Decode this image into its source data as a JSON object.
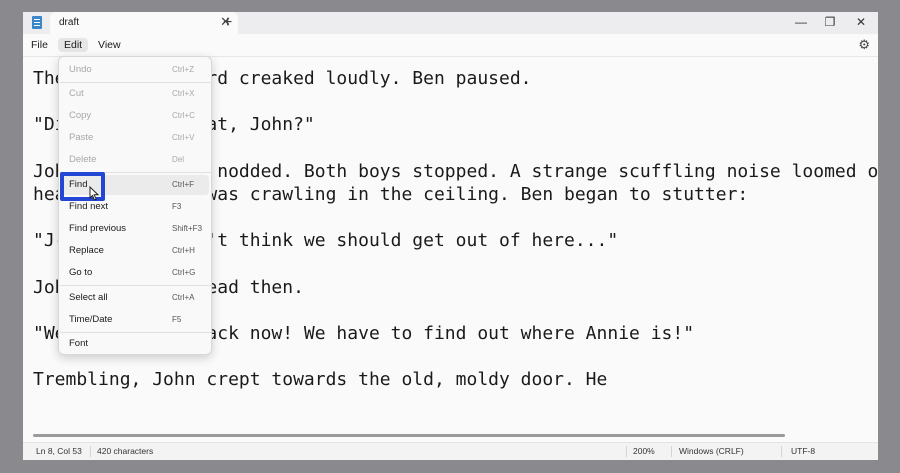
{
  "titlebar": {
    "tab_title": "draft",
    "tab_close": "✕",
    "new_tab": "+",
    "minimize": "—",
    "maximize": "❐",
    "close": "✕"
  },
  "menubar": {
    "file": "File",
    "edit": "Edit",
    "view": "View",
    "settings_icon": "⚙"
  },
  "editor": {
    "lines": [
      "The old floorboard creaked loudly. Ben paused.",
      "\"Did you hear that, John?\"",
      "John, eyes wide, nodded. Both boys stopped. A strange scuffling noise loomed ove",
      "head. Something was crawling in the ceiling. Ben began to stutter:",
      "\"J-J-John, I don't think we should get out of here...\"",
      "John shook his head then.",
      "\"We can't turn back now! We have to find out where Annie is!\"",
      "Trembling, John crept towards the old, moldy door. He"
    ]
  },
  "edit_menu": {
    "items": [
      {
        "label": "Undo",
        "shortcut": "Ctrl+Z",
        "disabled": true
      },
      {
        "label": "Cut",
        "shortcut": "Ctrl+X",
        "disabled": true
      },
      {
        "label": "Copy",
        "shortcut": "Ctrl+C",
        "disabled": true
      },
      {
        "label": "Paste",
        "shortcut": "Ctrl+V",
        "disabled": true
      },
      {
        "label": "Delete",
        "shortcut": "Del",
        "disabled": true
      },
      {
        "label": "Find",
        "shortcut": "Ctrl+F",
        "disabled": false
      },
      {
        "label": "Find next",
        "shortcut": "F3",
        "disabled": false
      },
      {
        "label": "Find previous",
        "shortcut": "Shift+F3",
        "disabled": false
      },
      {
        "label": "Replace",
        "shortcut": "Ctrl+H",
        "disabled": false
      },
      {
        "label": "Go to",
        "shortcut": "Ctrl+G",
        "disabled": false
      },
      {
        "label": "Select all",
        "shortcut": "Ctrl+A",
        "disabled": false
      },
      {
        "label": "Time/Date",
        "shortcut": "F5",
        "disabled": false
      },
      {
        "label": "Font",
        "shortcut": "",
        "disabled": false
      }
    ]
  },
  "statusbar": {
    "position": "Ln 8, Col 53",
    "characters": "420 characters",
    "zoom": "200%",
    "line_ending": "Windows (CRLF)",
    "encoding": "UTF-8"
  },
  "colors": {
    "highlight_box": "#2446d4",
    "app_icon": "#3a86c8"
  }
}
